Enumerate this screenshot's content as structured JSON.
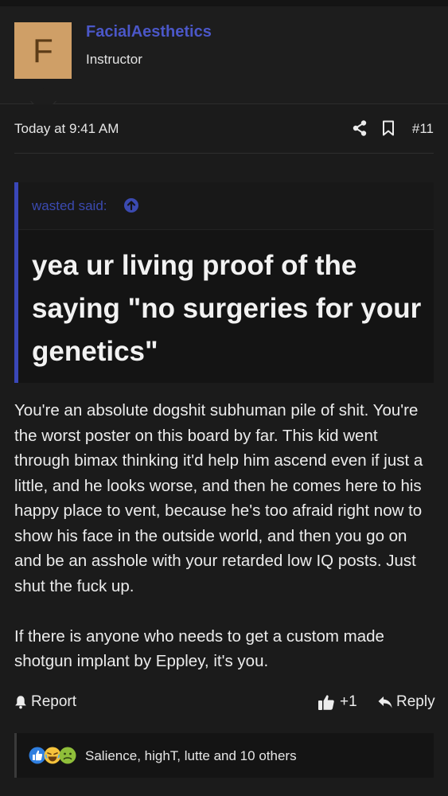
{
  "author": {
    "avatar_letter": "F",
    "username": "FacialAesthetics",
    "title": "Instructor",
    "avatar_color": "#cf9f67",
    "username_color": "#4b57c8"
  },
  "post": {
    "date": "Today at 9:41 AM",
    "number": "#11",
    "icons": [
      "share-icon",
      "bookmark-icon"
    ]
  },
  "quote": {
    "attribution": "wasted said:",
    "attribution_icon": "arrow-up-circle-icon",
    "text": "yea ur living proof of the saying \"no surgeries for your genetics\""
  },
  "message": {
    "paragraphs": [
      "You're an absolute dogshit subhuman pile of shit. You're the worst poster on this board by far. This kid went through bimax thinking it'd help him ascend even if just a little, and he looks worse, and then he comes here to his happy place to vent, because he's too afraid right now to show his face in the outside world, and then you go on and be an asshole with your retarded low IQ posts. Just shut the fuck up.",
      "If there is anyone who needs to get a custom made shotgun implant by Eppley, it's you."
    ]
  },
  "actions": {
    "report_label": "Report",
    "like_count": "+1",
    "reply_label": "Reply"
  },
  "reactions": {
    "icons": [
      "like-reaction-icon",
      "laugh-reaction-icon",
      "sick-reaction-icon"
    ],
    "summary": "Salience, highT, lutte and 10 others"
  }
}
